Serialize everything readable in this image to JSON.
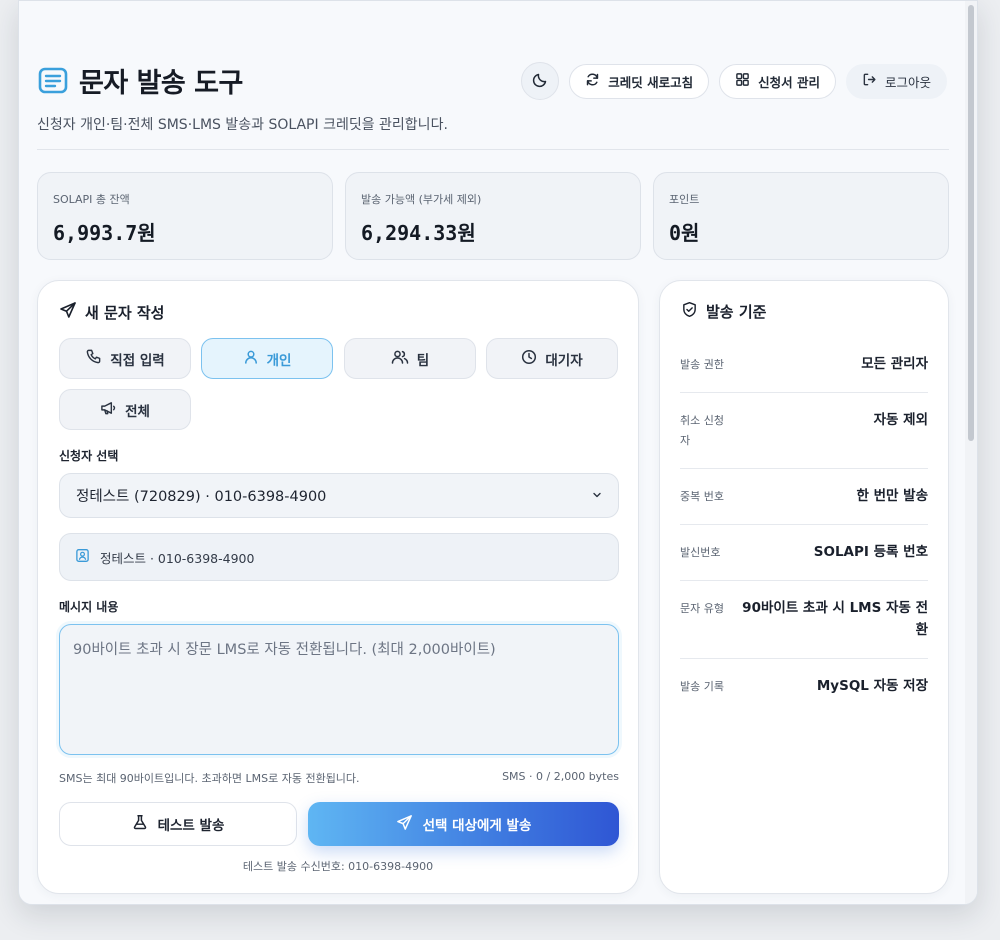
{
  "header": {
    "title": "문자 발송 도구",
    "subtitle": "신청자 개인·팀·전체 SMS·LMS 발송과 SOLAPI 크레딧을 관리합니다."
  },
  "toolbar": {
    "refresh_label": "크레딧 새로고침",
    "applications_label": "신청서 관리",
    "logout_label": "로그아웃"
  },
  "stats": [
    {
      "label": "SOLAPI 총 잔액",
      "value": "6,993.7원"
    },
    {
      "label": "발송 가능액 (부가세 제외)",
      "value": "6,294.33원"
    },
    {
      "label": "포인트",
      "value": "0원"
    }
  ],
  "compose": {
    "title": "새 문자 작성",
    "modes": [
      {
        "label": "직접 입력",
        "icon": "phone-icon"
      },
      {
        "label": "개인",
        "icon": "user-icon",
        "active": true
      },
      {
        "label": "팀",
        "icon": "users-icon"
      },
      {
        "label": "대기자",
        "icon": "clock-icon"
      },
      {
        "label": "전체",
        "icon": "megaphone-icon"
      }
    ],
    "applicant_label": "신청자 선택",
    "applicant_selected": "정테스트 (720829) · 010-6398-4900",
    "selected_summary": "정테스트 · 010-6398-4900",
    "message_label": "메시지 내용",
    "message_placeholder": "90바이트 초과 시 장문 LMS로 자동 전환됩니다. (최대 2,000바이트)",
    "help_text": "SMS는 최대 90바이트입니다. 초과하면 LMS로 자동 전환됩니다.",
    "byte_counter": "SMS · 0 / 2,000 bytes",
    "test_button": "테스트 발송",
    "send_button": "선택 대상에게 발송",
    "test_note": "테스트 발송 수신번호: 010-6398-4900"
  },
  "rules": {
    "title": "발송 기준",
    "items": [
      {
        "key": "발송 권한",
        "value": "모든 관리자"
      },
      {
        "key": "취소 신청자",
        "value": "자동 제외"
      },
      {
        "key": "중복 번호",
        "value": "한 번만 발송"
      },
      {
        "key": "발신번호",
        "value": "SOLAPI 등록 번호"
      },
      {
        "key": "문자 유형",
        "value": "90바이트 초과 시 LMS 자동 전환"
      },
      {
        "key": "발송 기록",
        "value": "MySQL 자동 저장"
      }
    ]
  },
  "colors": {
    "accent": "#3a9ad8",
    "send_gradient_start": "#5fb6f3",
    "send_gradient_end": "#2f56d4"
  }
}
